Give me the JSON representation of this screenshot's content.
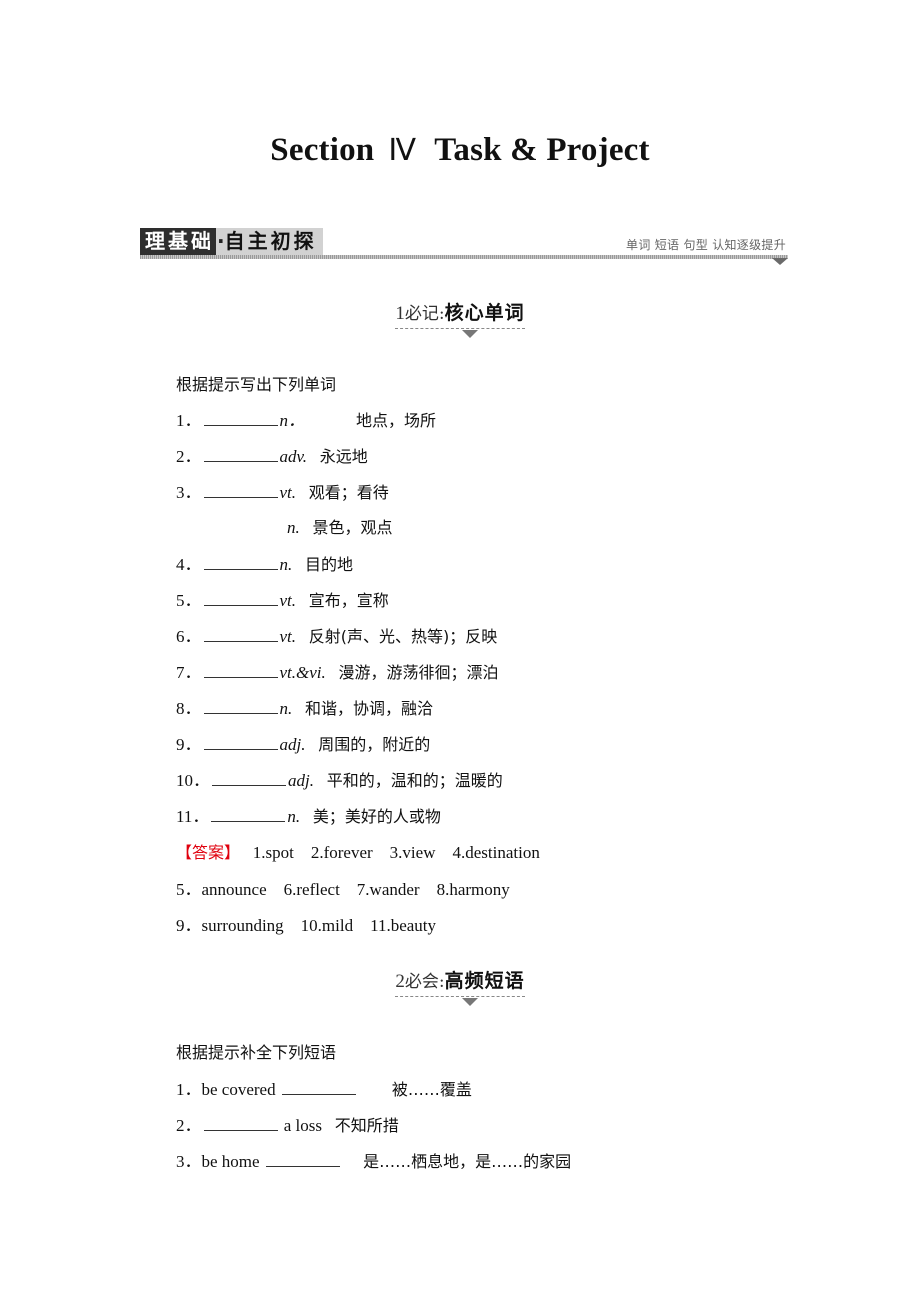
{
  "title": {
    "prefix": "Section",
    "roman": "Ⅳ",
    "main": "Task & Project"
  },
  "banner": {
    "dark_label": "理基础",
    "separator": "·",
    "light_label": "自主初探",
    "right_text": "单词 短语 句型 认知逐级提升"
  },
  "section1": {
    "num": "1",
    "pre": "必记:",
    "bold": "核心单词",
    "instruction": "根据提示写出下列单词",
    "items": [
      {
        "num": "1．",
        "pos": "n．",
        "meaning": "地点，场所"
      },
      {
        "num": "2．",
        "pos": "adv.",
        "meaning": "永远地"
      },
      {
        "num": "3．",
        "pos": "vt.",
        "meaning": "观看；看待"
      },
      {
        "num": "",
        "pos": "n.",
        "meaning": "景色，观点"
      },
      {
        "num": "4．",
        "pos": "n.",
        "meaning": "目的地"
      },
      {
        "num": "5．",
        "pos": "vt.",
        "meaning": "宣布，宣称"
      },
      {
        "num": "6．",
        "pos": "vt.",
        "meaning": "反射(声、光、热等)；反映"
      },
      {
        "num": "7．",
        "pos": "vt.&vi.",
        "meaning": "漫游，游荡徘徊；漂泊"
      },
      {
        "num": "8．",
        "pos": "n.",
        "meaning": "和谐，协调，融洽"
      },
      {
        "num": "9．",
        "pos": "adj.",
        "meaning": "周围的，附近的"
      },
      {
        "num": "10．",
        "pos": "adj.",
        "meaning": "平和的，温和的；温暖的"
      },
      {
        "num": "11．",
        "pos": "n.",
        "meaning": "美；美好的人或物"
      }
    ],
    "answer_label": "【答案】",
    "answers": [
      "1.spot    2.forever    3.view    4.destination",
      "5．announce    6.reflect    7.wander    8.harmony",
      "9．surrounding    10.mild    11.beauty"
    ]
  },
  "section2": {
    "num": "2",
    "pre": "必会:",
    "bold": "高频短语",
    "instruction": "根据提示补全下列短语",
    "items": [
      {
        "num": "1．",
        "before": "be covered ",
        "after": "",
        "meaning": "被……覆盖"
      },
      {
        "num": "2．",
        "before": "",
        "after": " a loss",
        "meaning": "不知所措"
      },
      {
        "num": "3．",
        "before": "be home ",
        "after": "",
        "meaning": "是……栖息地，是……的家园"
      }
    ]
  }
}
